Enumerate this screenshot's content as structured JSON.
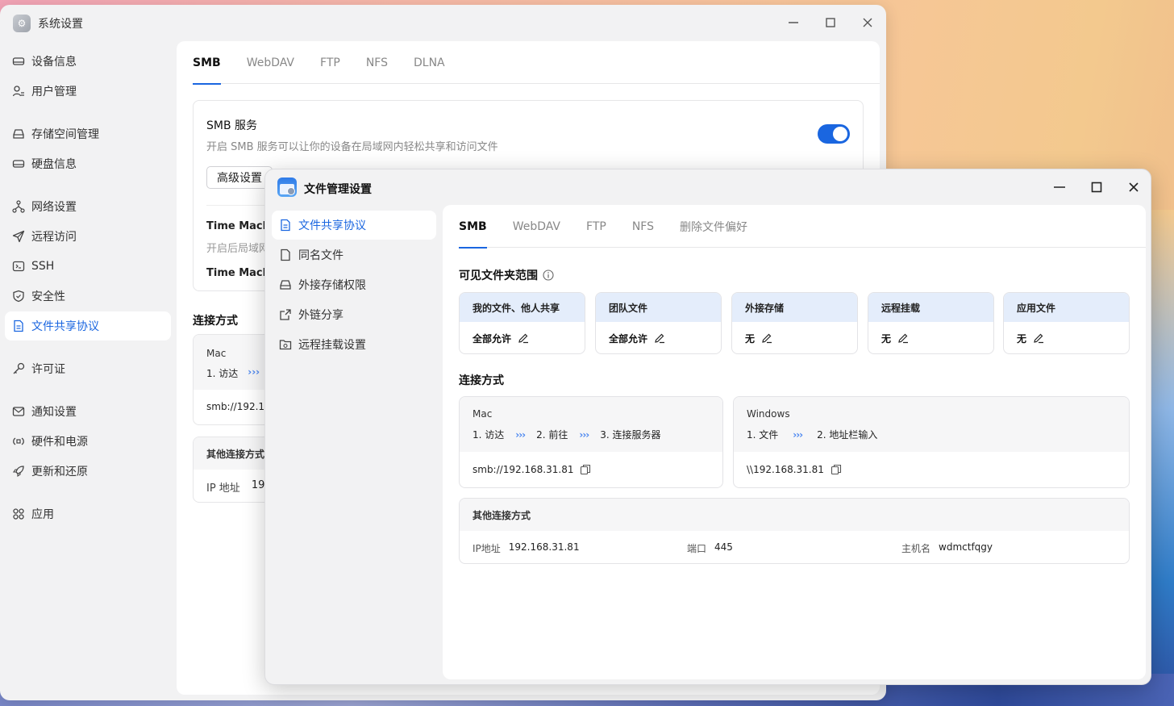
{
  "back_window": {
    "title": "系统设置",
    "sidebar": [
      {
        "label": "设备信息",
        "icon": "device-icon"
      },
      {
        "label": "用户管理",
        "icon": "user-icon"
      },
      {
        "label": "存储空间管理",
        "icon": "storage-icon"
      },
      {
        "label": "硬盘信息",
        "icon": "disk-icon"
      },
      {
        "label": "网络设置",
        "icon": "network-icon"
      },
      {
        "label": "远程访问",
        "icon": "send-icon"
      },
      {
        "label": "SSH",
        "icon": "terminal-icon"
      },
      {
        "label": "安全性",
        "icon": "shield-icon"
      },
      {
        "label": "文件共享协议",
        "icon": "file-icon",
        "active": true
      },
      {
        "label": "许可证",
        "icon": "key-icon"
      },
      {
        "label": "通知设置",
        "icon": "mail-icon"
      },
      {
        "label": "硬件和电源",
        "icon": "hardware-icon"
      },
      {
        "label": "更新和还原",
        "icon": "rocket-icon"
      },
      {
        "label": "应用",
        "icon": "apps-icon"
      }
    ],
    "tabs": [
      "SMB",
      "WebDAV",
      "FTP",
      "NFS",
      "DLNA"
    ],
    "smb_service": {
      "title": "SMB 服务",
      "desc": "开启 SMB 服务可以让你的设备在局域网内轻松共享和访问文件",
      "advanced_label": "高级设置",
      "enabled": true
    },
    "time_machine_title": "Time Machi",
    "time_machine_desc": "开启后局域网",
    "time_machine_title2": "Time Machi",
    "connection_section": "连接方式",
    "conn_os": "Mac",
    "conn_step1": "1. 访达",
    "conn_arrows": "›››",
    "conn_addr": "smb://192.168",
    "other_title": "其他连接方式",
    "ip_label": "IP 地址",
    "ip_value_partial": "19"
  },
  "front_window": {
    "title": "文件管理设置",
    "sidebar": [
      {
        "label": "文件共享协议",
        "icon": "doc-icon",
        "active": true
      },
      {
        "label": "同名文件",
        "icon": "file-icon"
      },
      {
        "label": "外接存储权限",
        "icon": "storage-icon"
      },
      {
        "label": "外链分享",
        "icon": "share-icon"
      },
      {
        "label": "远程挂载设置",
        "icon": "folder-icon"
      }
    ],
    "tabs": [
      "SMB",
      "WebDAV",
      "FTP",
      "NFS",
      "删除文件偏好"
    ],
    "scope_title": "可见文件夹范围",
    "scopes": [
      {
        "head": "我的文件、他人共享",
        "value": "全部允许"
      },
      {
        "head": "团队文件",
        "value": "全部允许"
      },
      {
        "head": "外接存储",
        "value": "无"
      },
      {
        "head": "远程挂载",
        "value": "无"
      },
      {
        "head": "应用文件",
        "value": "无"
      }
    ],
    "connection_title": "连接方式",
    "mac": {
      "os": "Mac",
      "steps": [
        "1. 访达",
        "2. 前往",
        "3. 连接服务器"
      ],
      "arrows": "›››",
      "address": "smb://192.168.31.81"
    },
    "windows": {
      "os": "Windows",
      "steps": [
        "1. 文件",
        "2. 地址栏输入"
      ],
      "arrows": "›››",
      "address": "\\\\192.168.31.81"
    },
    "other": {
      "title": "其他连接方式",
      "ip_label": "IP地址",
      "ip_value": "192.168.31.81",
      "port_label": "端口",
      "port_value": "445",
      "host_label": "主机名",
      "host_value": "wdmctfqgy"
    }
  },
  "colors": {
    "accent": "#1a66e0",
    "scope_head_bg": "#e4edfb"
  }
}
